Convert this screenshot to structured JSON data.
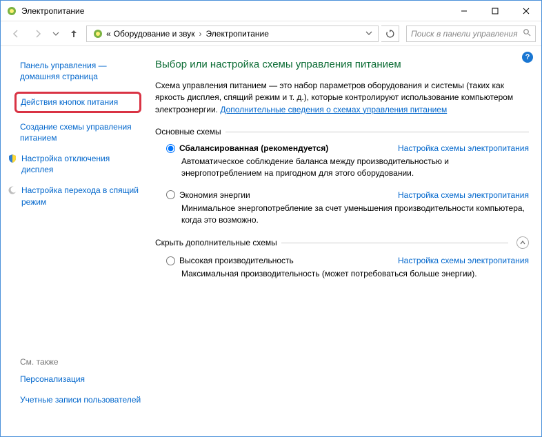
{
  "titlebar": {
    "title": "Электропитание"
  },
  "breadcrumb": {
    "prefix": "«",
    "seg1": "Оборудование и звук",
    "seg2": "Электропитание"
  },
  "search": {
    "placeholder": "Поиск в панели управления"
  },
  "sidebar": {
    "home": "Панель управления — домашняя страница",
    "power_buttons": "Действия кнопок питания",
    "create_plan": "Создание схемы управления питанием",
    "display_off": "Настройка отключения дисплея",
    "sleep": "Настройка перехода в спящий режим",
    "see_also_heading": "См. также",
    "personalization": "Персонализация",
    "user_accounts": "Учетные записи пользователей"
  },
  "main": {
    "heading": "Выбор или настройка схемы управления питанием",
    "desc_pre": "Схема управления питанием — это набор параметров оборудования и системы (таких как яркость дисплея, спящий режим и т. д.), которые контролируют использование компьютером электроэнергии. ",
    "desc_link": "Дополнительные сведения о схемах управления питанием",
    "section_basic": "Основные схемы",
    "section_more": "Скрыть дополнительные схемы",
    "plan_settings_link": "Настройка схемы электропитания",
    "plans": {
      "balanced": {
        "title": "Сбалансированная (рекомендуется)",
        "desc": "Автоматическое соблюдение баланса между производительностью и энергопотреблением на пригодном для этого оборудовании."
      },
      "saver": {
        "title": "Экономия энергии",
        "desc": "Минимальное энергопотребление за счет уменьшения производительности компьютера, когда это возможно."
      },
      "high": {
        "title": "Высокая производительность",
        "desc": "Максимальная производительность (может потребоваться больше энергии)."
      }
    }
  }
}
